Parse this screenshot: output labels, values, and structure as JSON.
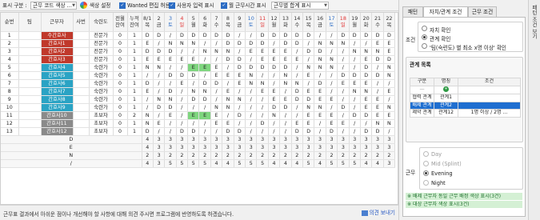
{
  "toolbar": {
    "display_label": "표시 구분 :",
    "display_value": "근무 코드 색상 ...",
    "color_setting": "색상 설정",
    "wanted_edit": "Wanted 편집 허용",
    "user_input": "사용자 입력 표시",
    "month_hours": "월 근무시간 표시",
    "sum_dropdown": "근무별 합계 표시"
  },
  "grid": {
    "headers": {
      "seq": "순번",
      "team": "팀",
      "worker": "근무자",
      "empno": "사번",
      "skill": "숙련도",
      "prev_line1": "전월",
      "prev_line2": "잔여",
      "acc_line1": "누적",
      "acc_line2": "잔여"
    },
    "days": [
      {
        "d": "8/1",
        "w": "목"
      },
      {
        "d": "2",
        "w": "금"
      },
      {
        "d": "3",
        "w": "토"
      },
      {
        "d": "4",
        "w": "일"
      },
      {
        "d": "5",
        "w": "월"
      },
      {
        "d": "6",
        "w": "화"
      },
      {
        "d": "7",
        "w": "수"
      },
      {
        "d": "8",
        "w": "목"
      },
      {
        "d": "9",
        "w": "금"
      },
      {
        "d": "10",
        "w": "토"
      },
      {
        "d": "11",
        "w": "일"
      },
      {
        "d": "12",
        "w": "월"
      },
      {
        "d": "13",
        "w": "화"
      },
      {
        "d": "14",
        "w": "수"
      },
      {
        "d": "15",
        "w": "목"
      },
      {
        "d": "16",
        "w": "금"
      },
      {
        "d": "17",
        "w": "토"
      },
      {
        "d": "18",
        "w": "일"
      },
      {
        "d": "19",
        "w": "월"
      },
      {
        "d": "20",
        "w": "화"
      },
      {
        "d": "21",
        "w": "수"
      },
      {
        "d": "22",
        "w": "목"
      }
    ],
    "rows": [
      {
        "seq": "1",
        "name": "수간호사",
        "color": "#c0392b",
        "skill": "전문가",
        "prev": "0",
        "acc": "1",
        "shifts": [
          "D",
          "D",
          "/",
          "D",
          "D",
          "D",
          "D",
          "D",
          "/",
          "/",
          "D",
          "D",
          "D",
          "D",
          "D",
          "/",
          "/",
          "D",
          "D",
          "D",
          "D",
          "D"
        ],
        "green": []
      },
      {
        "seq": "2",
        "name": "간호사1",
        "color": "#c0392b",
        "skill": "전문가",
        "prev": "0",
        "acc": "1",
        "shifts": [
          "E",
          "/",
          "N",
          "N",
          "N",
          "/",
          "/",
          "D",
          "D",
          "D",
          "D",
          "/",
          "D",
          "D",
          "/",
          "N",
          "N",
          "N",
          "/",
          "/",
          "E",
          "E"
        ],
        "green": []
      },
      {
        "seq": "3",
        "name": "간호사2",
        "color": "#c0392b",
        "skill": "전문가",
        "prev": "0",
        "acc": "1",
        "shifts": [
          "D",
          "D",
          "D",
          "/",
          "/",
          "N",
          "N",
          "N",
          "/",
          "E",
          "E",
          "E",
          "E",
          "/",
          "D",
          "D",
          "/",
          "/",
          "N",
          "N",
          "N",
          "E"
        ],
        "green": []
      },
      {
        "seq": "4",
        "name": "간호사3",
        "color": "#c0392b",
        "skill": "전문가",
        "prev": "0",
        "acc": "1",
        "shifts": [
          "E",
          "E",
          "E",
          "E",
          "E",
          "/",
          "/",
          "D",
          "D",
          "/",
          "E",
          "E",
          "E",
          "E",
          "/",
          "N",
          "N",
          "/",
          "/",
          "E",
          "D",
          "D"
        ],
        "green": []
      },
      {
        "seq": "5",
        "name": "간호사4",
        "color": "#2aa3c4",
        "skill": "숙련가",
        "prev": "0",
        "acc": "1",
        "shifts": [
          "N",
          "N",
          "/",
          "/",
          "E",
          "E",
          "E",
          "/",
          "D",
          "D",
          "D",
          "D",
          "D",
          "/",
          "N",
          "N",
          "N",
          "/",
          "/",
          "D",
          "/",
          "N"
        ],
        "green": [
          4,
          5
        ]
      },
      {
        "seq": "6",
        "name": "간호사5",
        "color": "#2aa3c4",
        "skill": "숙련가",
        "prev": "0",
        "acc": "1",
        "shifts": [
          "/",
          "/",
          "D",
          "D",
          "D",
          "/",
          "E",
          "E",
          "E",
          "N",
          "/",
          "/",
          "N",
          "/",
          "E",
          "/",
          "/",
          "D",
          "D",
          "D",
          "D",
          "N"
        ],
        "green": []
      },
      {
        "seq": "7",
        "name": "간호사6",
        "color": "#2aa3c4",
        "skill": "숙련가",
        "prev": "0",
        "acc": "1",
        "shifts": [
          "D",
          "/",
          "/",
          "E",
          "/",
          "D",
          "D",
          "/",
          "E",
          "N",
          "N",
          "/",
          "N",
          "N",
          "/",
          "D",
          "/",
          "E",
          "E",
          "E",
          "/",
          "/"
        ],
        "green": []
      },
      {
        "seq": "8",
        "name": "간호사7",
        "color": "#2aa3c4",
        "skill": "숙련가",
        "prev": "0",
        "acc": "1",
        "shifts": [
          "E",
          "/",
          "D",
          "/",
          "N",
          "N",
          "/",
          "E",
          "/",
          "/",
          "E",
          "E",
          "/",
          "D",
          "E",
          "E",
          "/",
          "/",
          "N",
          "N",
          "/",
          "E"
        ],
        "green": []
      },
      {
        "seq": "9",
        "name": "간호사8",
        "color": "#2aa3c4",
        "skill": "숙련가",
        "prev": "0",
        "acc": "1",
        "shifts": [
          "/",
          "N",
          "N",
          "/",
          "D",
          "D",
          "/",
          "N",
          "N",
          "/",
          "/",
          "E",
          "E",
          "D",
          "D",
          "E",
          "E",
          "/",
          "/",
          "E",
          "E",
          "/"
        ],
        "green": []
      },
      {
        "seq": "10",
        "name": "간호사9",
        "color": "#2aa3c4",
        "skill": "숙련가",
        "prev": "0",
        "acc": "1",
        "shifts": [
          "/",
          "D",
          "D",
          "/",
          "/",
          "/",
          "N",
          "N",
          "/",
          "/",
          "/",
          "D",
          "D",
          "/",
          "N",
          "N",
          "/",
          "D",
          "/",
          "E",
          "E",
          "N"
        ],
        "green": []
      },
      {
        "seq": "11",
        "name": "간호사10",
        "color": "#8a8a8a",
        "skill": "초보자",
        "prev": "0",
        "acc": "2",
        "shifts": [
          "N",
          "/",
          "E",
          "/",
          "E",
          "E",
          "E",
          "/",
          "D",
          "/",
          "/",
          "N",
          "/",
          "/",
          "E",
          "E",
          "E",
          "/",
          "D",
          "D",
          "E",
          "E"
        ],
        "green": [
          4,
          5
        ]
      },
      {
        "seq": "12",
        "name": "간호사11",
        "color": "#8a8a8a",
        "skill": "초보자",
        "prev": "0",
        "acc": "1",
        "shifts": [
          "N",
          "E",
          "/",
          "/",
          "/",
          "/",
          "E",
          "E",
          "/",
          "/",
          "D",
          "/",
          "/",
          "E",
          "E",
          "/",
          "E",
          "E",
          "/",
          "/",
          "N",
          "N"
        ],
        "green": []
      },
      {
        "seq": "13",
        "name": "간호사12",
        "color": "#8a8a8a",
        "skill": "초보자",
        "prev": "0",
        "acc": "1",
        "shifts": [
          "D",
          "/",
          "/",
          "D",
          "D",
          "/",
          "/",
          "D",
          "D",
          "/",
          "/",
          "/",
          "/",
          "D",
          "D",
          "/",
          "D",
          "/",
          "/",
          "D",
          "D",
          "/"
        ],
        "green": []
      }
    ],
    "sums": [
      {
        "label": "D",
        "values": [
          "4",
          "3",
          "3",
          "3",
          "3",
          "3",
          "3",
          "3",
          "3",
          "3",
          "3",
          "3",
          "3",
          "3",
          "3",
          "3",
          "3",
          "3",
          "3",
          "3",
          "3",
          "3"
        ]
      },
      {
        "label": "E",
        "values": [
          "4",
          "3",
          "3",
          "3",
          "3",
          "3",
          "3",
          "3",
          "3",
          "3",
          "3",
          "3",
          "3",
          "3",
          "3",
          "3",
          "3",
          "3",
          "3",
          "3",
          "3",
          "3"
        ]
      },
      {
        "label": "N",
        "values": [
          "2",
          "3",
          "2",
          "2",
          "2",
          "2",
          "2",
          "2",
          "2",
          "2",
          "2",
          "2",
          "2",
          "2",
          "2",
          "2",
          "2",
          "2",
          "2",
          "2",
          "2",
          "2"
        ]
      },
      {
        "label": "/",
        "values": [
          "4",
          "3",
          "5",
          "5",
          "5",
          "5",
          "4",
          "4",
          "5",
          "5",
          "5",
          "4",
          "4",
          "4",
          "5",
          "4",
          "5",
          "5",
          "5",
          "4",
          "4",
          "3"
        ]
      }
    ]
  },
  "status": {
    "message": "근무표 결과에서 아쉬운 점이나 개선해야 할 사항에 대해 의견 주시면 프로그램에 반영하도록 하겠습니다.",
    "feedback_button": "의견 보내기"
  },
  "panel": {
    "tabs": [
      "패턴",
      "자치/관계 조건",
      "근무 조건"
    ],
    "condition_label": "조건",
    "condition_options": [
      "자치 확인",
      "관계 확인",
      "'팀(숙련도) 별 최소 x명 이상' 확인"
    ],
    "relation_list_title": "관계 목록",
    "relation_headers": [
      "구분",
      "명칭",
      "조건"
    ],
    "relation_rows": [
      {
        "type": "",
        "name": "",
        "cond": ""
      },
      {
        "type": "협력 관계",
        "name": "관계1",
        "cond": "-"
      },
      {
        "type": "배제 관계",
        "name": "관계2",
        "cond": "-"
      },
      {
        "type": "제약 관계",
        "name": "관계12",
        "cond": "1명 이상 / 2명 ..."
      }
    ],
    "shift_label": "근무",
    "shift_options": [
      "Day",
      "Mid (Splint)",
      "Evening",
      "Night"
    ],
    "notes": [
      "※ 배제 근무자 동일 근무 배정 색상 표시(3건)",
      "※ 대상 근무자 색상 표시(3건)"
    ],
    "side_tab": "패턴 조건 보기"
  }
}
